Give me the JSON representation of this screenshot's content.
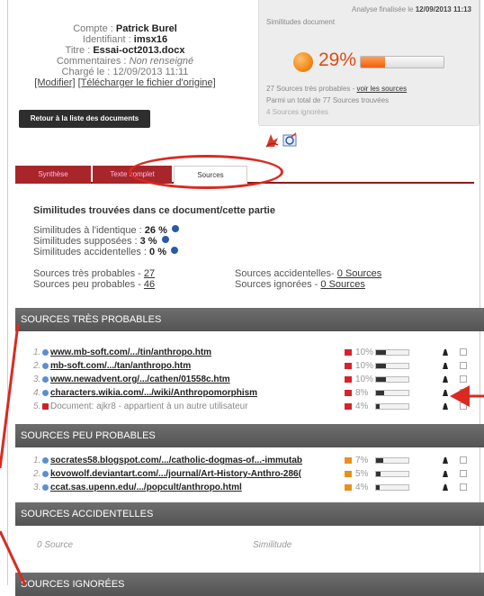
{
  "header": {
    "compte_label": "Compte :",
    "compte_value": "Patrick Burel",
    "ident_label": "Identifiant :",
    "ident_value": "imsx16",
    "titre_label": "Titre :",
    "titre_value": "Essai-oct2013.docx",
    "comment_label": "Commentaires :",
    "comment_value": "Non renseigné",
    "charge_label": "Chargé le :",
    "charge_value": "12/09/2013 11:11",
    "link_modifier": "[Modifier]",
    "link_download": "[Télécharger le fichier d'origine]",
    "back_button": "Retour à la liste des documents"
  },
  "analysis": {
    "finalized_label": "Analyse finalisée le",
    "finalized_value": "12/09/2013 11:13",
    "sim_doc": "Similitudes document",
    "percent_text": "29%",
    "percent_value": 29,
    "line1_text": "27 Sources très probables -",
    "line1_link": "voir les sources",
    "line2": "Parmi un total de 77 Sources trouvées",
    "line3": "4 Sources ignorées"
  },
  "tabs": [
    {
      "label": "Synthèse"
    },
    {
      "label": "Texte complet"
    },
    {
      "label": "Sources"
    }
  ],
  "summary": {
    "heading": "Similitudes trouvées dans ce document/cette partie",
    "identique_label": "Similitudes à l'identique :",
    "identique_value": "26 %",
    "supposees_label": "Similitudes supposées :",
    "supposees_value": "3 %",
    "accidentelles_label": "Similitudes accidentelles :",
    "accidentelles_value": "0 %",
    "tres_probables_label": "Sources très probables -",
    "tres_probables_value": "27",
    "peu_probables_label": "Sources peu probables -",
    "peu_probables_value": "46",
    "src_accidentelles_label": "Sources accidentelles-",
    "src_accidentelles_value": "0 Sources",
    "src_ignorees_label": "Sources ignorées -",
    "src_ignorees_value": "0 Sources"
  },
  "sections": {
    "tres_probables": "SOURCES TRÈS PROBABLES",
    "peu_probables": "SOURCES PEU PROBABLES",
    "accidentelles": "SOURCES ACCIDENTELLES",
    "ignorees": "SOURCES IGNORÉES"
  },
  "tres_probables_rows": [
    {
      "num": "1.",
      "url": "www.mb-soft.com/.../tin/anthropo.htm",
      "pct": "10%",
      "value": 10,
      "type": "web"
    },
    {
      "num": "2.",
      "url": "mb-soft.com/.../tan/anthropo.htm",
      "pct": "10%",
      "value": 10,
      "type": "web"
    },
    {
      "num": "3.",
      "url": "www.newadvent.org/.../cathen/01558c.htm",
      "pct": "10%",
      "value": 10,
      "type": "web"
    },
    {
      "num": "4.",
      "url": "characters.wikia.com/.../wiki/Anthropomorphism",
      "pct": "8%",
      "value": 8,
      "type": "web"
    },
    {
      "num": "5.",
      "url": "Document: ajkr8 - appartient à un autre utilisateur",
      "pct": "4%",
      "value": 4,
      "type": "doc"
    }
  ],
  "peu_probables_rows": [
    {
      "num": "1.",
      "url": "socrates58.blogspot.com/.../catholic-dogmas-of...-immutab",
      "pct": "7%",
      "value": 7,
      "type": "web"
    },
    {
      "num": "2.",
      "url": "kovowolf.deviantart.com/.../journal/Art-History-Anthro-286(",
      "pct": "5%",
      "value": 5,
      "type": "web"
    },
    {
      "num": "3.",
      "url": "ccat.sas.upenn.edu/.../popcult/anthropo.html",
      "pct": "4%",
      "value": 4,
      "type": "web"
    }
  ],
  "accidentelles": {
    "count": "0 Source",
    "col": "Similitude"
  }
}
